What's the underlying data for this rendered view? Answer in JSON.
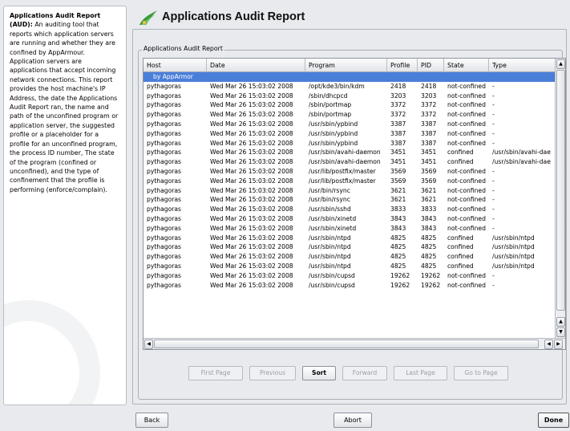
{
  "help": {
    "title": "Applications Audit Report (AUD):",
    "text": "An auditing tool that reports which application servers are running and whether they are confined by AppArmour. Application servers are applications that accept incoming network connections. This report provides the host machine's IP Address, the date the Applications Audit Report ran, the name and path of the unconfined program or application server, the suggested profile or a placeholder for a profile for an unconfined program, the process ID number, The state of the program (confined or unconfined), and the type of confinement that the profile is performing (enforce/complain)."
  },
  "header": {
    "title": "Applications Audit Report",
    "icon": "apparmor-logo-icon"
  },
  "group_label": "Applications Audit Report",
  "table": {
    "columns": [
      "Host",
      "Date",
      "Program",
      "Profile",
      "PID",
      "State",
      "Type"
    ],
    "group_row": "by AppArmor",
    "rows": [
      [
        "pythagoras",
        "Wed Mar 26 15:03:02 2008",
        "/opt/kde3/bin/kdm",
        "2418",
        "2418",
        "not-confined",
        "-"
      ],
      [
        "pythagoras",
        "Wed Mar 26 15:03:02 2008",
        "/sbin/dhcpcd",
        "3203",
        "3203",
        "not-confined",
        "-"
      ],
      [
        "pythagoras",
        "Wed Mar 26 15:03:02 2008",
        "/sbin/portmap",
        "3372",
        "3372",
        "not-confined",
        "-"
      ],
      [
        "pythagoras",
        "Wed Mar 26 15:03:02 2008",
        "/sbin/portmap",
        "3372",
        "3372",
        "not-confined",
        "-"
      ],
      [
        "pythagoras",
        "Wed Mar 26 15:03:02 2008",
        "/usr/sbin/ypbind",
        "3387",
        "3387",
        "not-confined",
        "-"
      ],
      [
        "pythagoras",
        "Wed Mar 26 15:03:02 2008",
        "/usr/sbin/ypbind",
        "3387",
        "3387",
        "not-confined",
        "-"
      ],
      [
        "pythagoras",
        "Wed Mar 26 15:03:02 2008",
        "/usr/sbin/ypbind",
        "3387",
        "3387",
        "not-confined",
        "-"
      ],
      [
        "pythagoras",
        "Wed Mar 26 15:03:02 2008",
        "/usr/sbin/avahi-daemon",
        "3451",
        "3451",
        "confined",
        "/usr/sbin/avahi-dae"
      ],
      [
        "pythagoras",
        "Wed Mar 26 15:03:02 2008",
        "/usr/sbin/avahi-daemon",
        "3451",
        "3451",
        "confined",
        "/usr/sbin/avahi-dae"
      ],
      [
        "pythagoras",
        "Wed Mar 26 15:03:02 2008",
        "/usr/lib/postfix/master",
        "3569",
        "3569",
        "not-confined",
        "-"
      ],
      [
        "pythagoras",
        "Wed Mar 26 15:03:02 2008",
        "/usr/lib/postfix/master",
        "3569",
        "3569",
        "not-confined",
        "-"
      ],
      [
        "pythagoras",
        "Wed Mar 26 15:03:02 2008",
        "/usr/bin/rsync",
        "3621",
        "3621",
        "not-confined",
        "-"
      ],
      [
        "pythagoras",
        "Wed Mar 26 15:03:02 2008",
        "/usr/bin/rsync",
        "3621",
        "3621",
        "not-confined",
        "-"
      ],
      [
        "pythagoras",
        "Wed Mar 26 15:03:02 2008",
        "/usr/sbin/sshd",
        "3833",
        "3833",
        "not-confined",
        "-"
      ],
      [
        "pythagoras",
        "Wed Mar 26 15:03:02 2008",
        "/usr/sbin/xinetd",
        "3843",
        "3843",
        "not-confined",
        "-"
      ],
      [
        "pythagoras",
        "Wed Mar 26 15:03:02 2008",
        "/usr/sbin/xinetd",
        "3843",
        "3843",
        "not-confined",
        "-"
      ],
      [
        "pythagoras",
        "Wed Mar 26 15:03:02 2008",
        "/usr/sbin/ntpd",
        "4825",
        "4825",
        "confined",
        "/usr/sbin/ntpd"
      ],
      [
        "pythagoras",
        "Wed Mar 26 15:03:02 2008",
        "/usr/sbin/ntpd",
        "4825",
        "4825",
        "confined",
        "/usr/sbin/ntpd"
      ],
      [
        "pythagoras",
        "Wed Mar 26 15:03:02 2008",
        "/usr/sbin/ntpd",
        "4825",
        "4825",
        "confined",
        "/usr/sbin/ntpd"
      ],
      [
        "pythagoras",
        "Wed Mar 26 15:03:02 2008",
        "/usr/sbin/ntpd",
        "4825",
        "4825",
        "confined",
        "/usr/sbin/ntpd"
      ],
      [
        "pythagoras",
        "Wed Mar 26 15:03:02 2008",
        "/usr/sbin/cupsd",
        "19262",
        "19262",
        "not-confined",
        "-"
      ],
      [
        "pythagoras",
        "Wed Mar 26 15:03:02 2008",
        "/usr/sbin/cupsd",
        "19262",
        "19262",
        "not-confined",
        "-"
      ]
    ]
  },
  "nav": {
    "first": "First Page",
    "previous": "Previous",
    "sort": "Sort",
    "forward": "Forward",
    "last": "Last Page",
    "goto": "Go to Page"
  },
  "footer": {
    "back": "Back",
    "abort": "Abort",
    "done": "Done"
  },
  "colors": {
    "selection": "#4a7fd9",
    "window_bg": "#e8eaee"
  }
}
